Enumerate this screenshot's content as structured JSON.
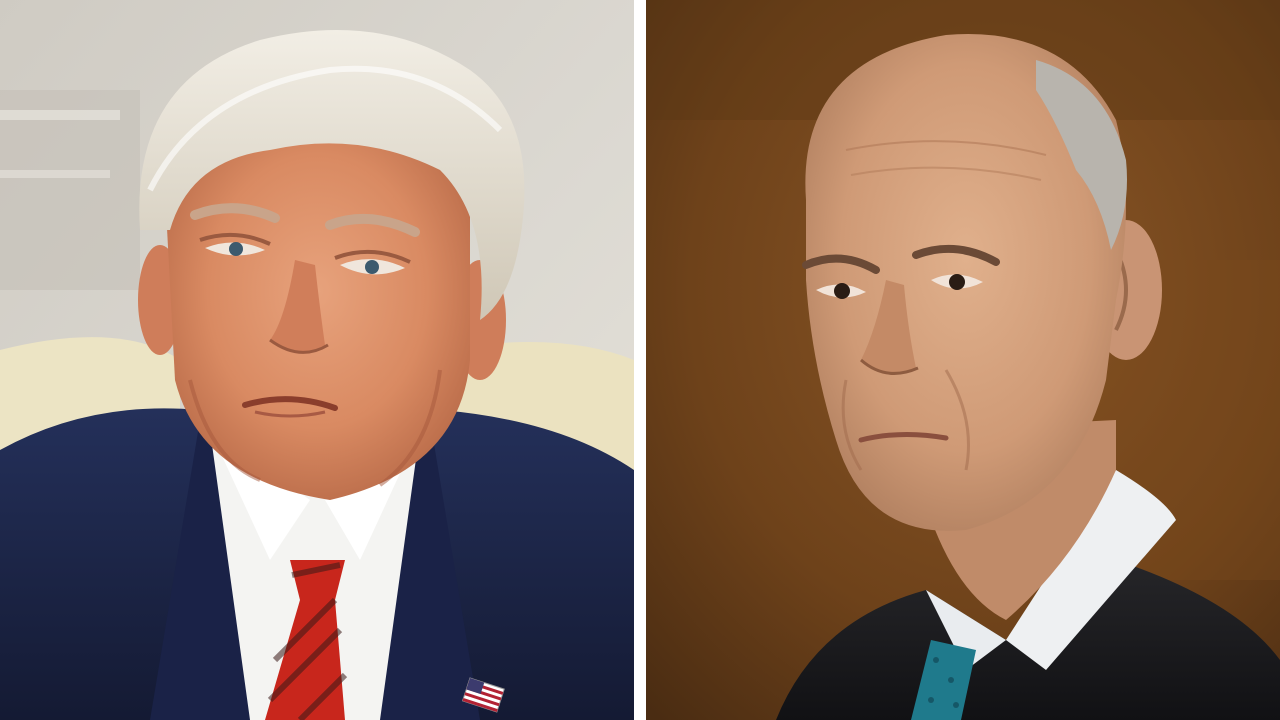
{
  "image": {
    "layout": "side-by-side-split",
    "panels": [
      {
        "subject": "man-in-navy-suit-portrait",
        "icons": [
          "american-flag-pin-icon"
        ]
      },
      {
        "subject": "man-in-judicial-robe-portrait"
      }
    ],
    "colors": {
      "divider": "#ffffff",
      "left_background": "#d7d4cd",
      "right_background": "#7a4a1f",
      "suit": "#1c2442",
      "tie": "#c8261c",
      "robe": "#18181c",
      "right_tie": "#1f7a8c"
    }
  }
}
